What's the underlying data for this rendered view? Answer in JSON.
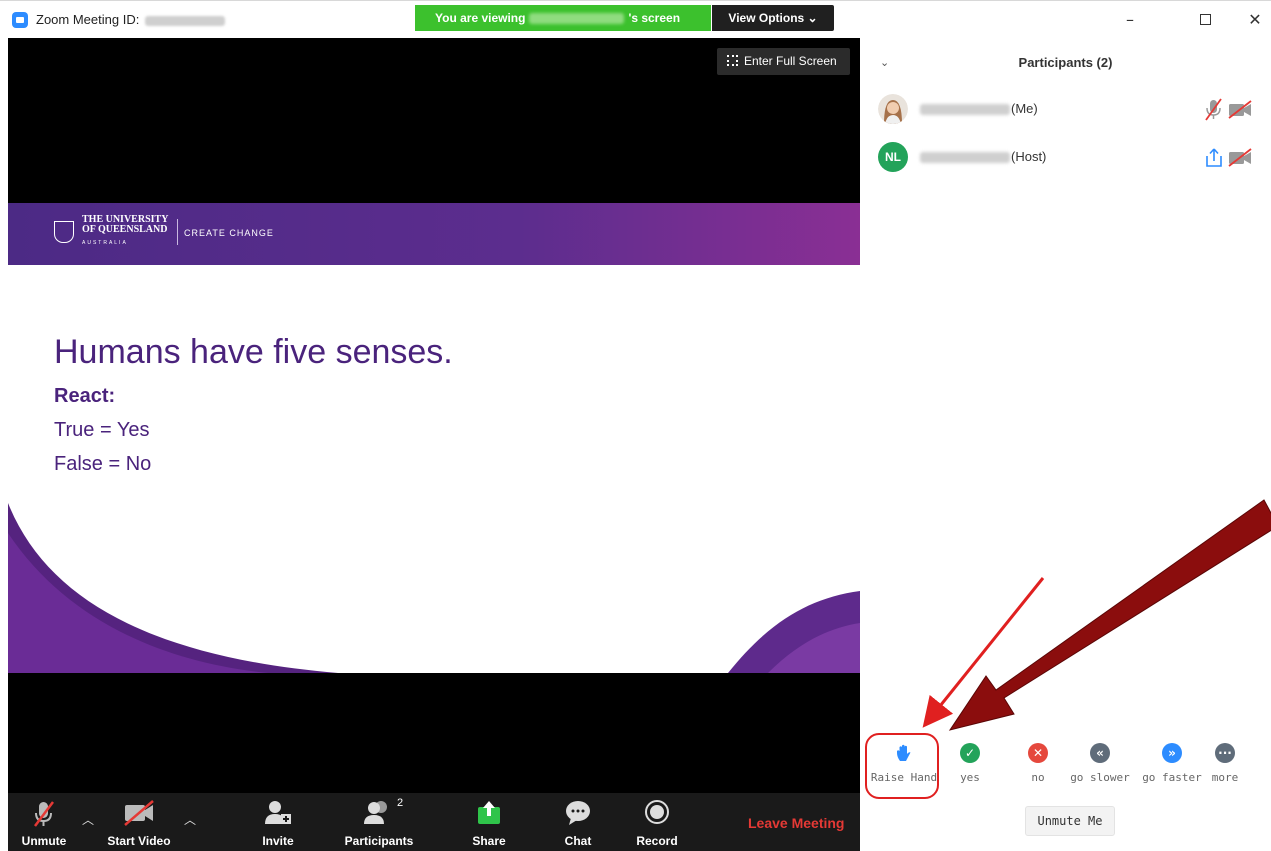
{
  "window": {
    "title": "Zoom Meeting ID:",
    "viewing_prefix": "You are viewing",
    "viewing_suffix": "'s screen",
    "view_options": "View Options ⌄"
  },
  "video": {
    "fullscreen_label": "Enter Full Screen"
  },
  "slide": {
    "university_line1": "THE UNIVERSITY",
    "university_line2": "OF QUEENSLAND",
    "country": "AUSTRALIA",
    "tagline": "CREATE CHANGE",
    "title": "Humans have five senses.",
    "react_label": "React:",
    "true_line": "True = Yes",
    "false_line": "False = No",
    "brand_color": "#4a237c"
  },
  "toolbar": {
    "unmute": "Unmute",
    "start_video": "Start Video",
    "invite": "Invite",
    "participants": "Participants",
    "participants_count": "2",
    "share": "Share",
    "chat": "Chat",
    "record": "Record",
    "leave": "Leave Meeting"
  },
  "panel": {
    "title": "Participants (2)",
    "participants": [
      {
        "role": "(Me)"
      },
      {
        "initials": "NL",
        "role": "(Host)"
      }
    ],
    "reactions": [
      {
        "label": "Raise Hand",
        "icon": "raised-hand",
        "color": "#2d8cff"
      },
      {
        "label": "yes",
        "icon": "check",
        "color": "#23a35a"
      },
      {
        "label": "no",
        "icon": "x",
        "color": "#e5483d"
      },
      {
        "label": "go slower",
        "icon": "double-left",
        "color": "#5f6c7a"
      },
      {
        "label": "go faster",
        "icon": "double-right",
        "color": "#2d8cff"
      },
      {
        "label": "more",
        "icon": "ellipsis",
        "color": "#5f6c7a"
      }
    ],
    "unmute_me": "Unmute Me"
  }
}
